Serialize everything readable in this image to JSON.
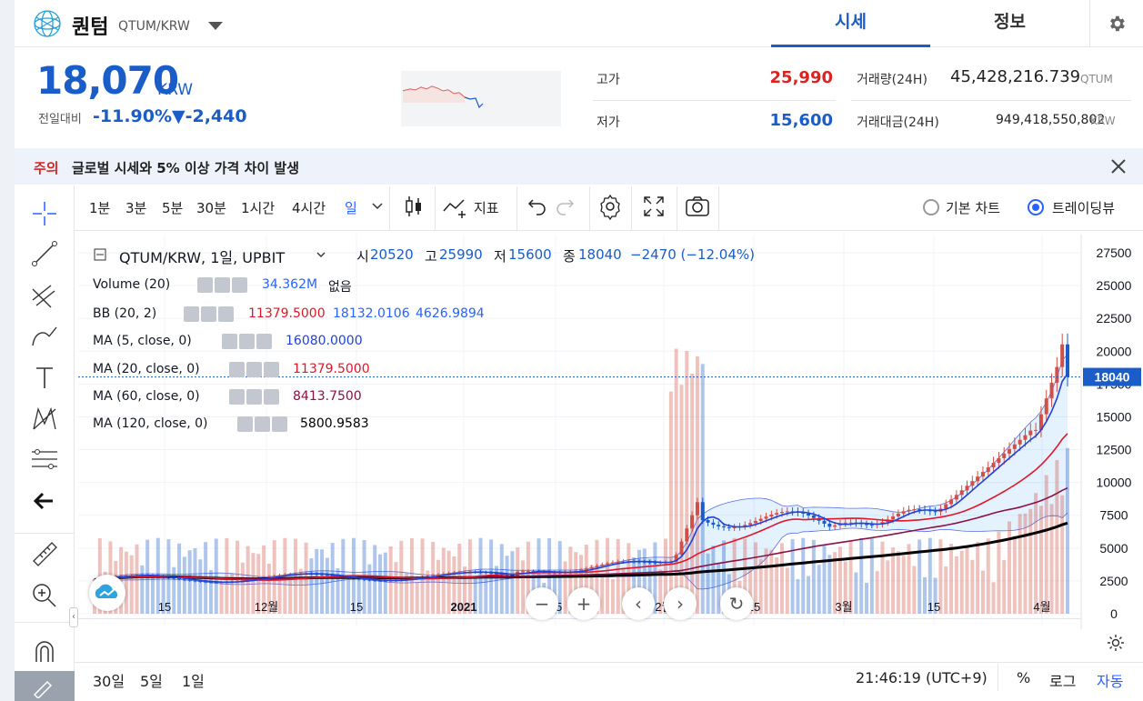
{
  "header": {
    "coin_name": "퀀텀",
    "pair": "QTUM/KRW",
    "tabs": [
      "시세",
      "정보"
    ]
  },
  "summary": {
    "price": "18,070",
    "unit": "KRW",
    "change_label": "전일대비",
    "change_pct": "-11.90%",
    "change_amt": "▼-2,440",
    "high_label": "고가",
    "high": "25,990",
    "low_label": "저가",
    "low": "15,600",
    "vol_label": "거래량(24H)",
    "vol": "45,428,216.739",
    "vol_unit": "QTUM",
    "amt_label": "거래대금(24H)",
    "amt": "949,418,550,802",
    "amt_unit": "KRW"
  },
  "notice": {
    "tag": "주의",
    "text": "글로벌 시세와 5% 이상 가격 차이 발생"
  },
  "toolbar": {
    "intervals": [
      "1분",
      "3분",
      "5분",
      "30분",
      "1시간",
      "4시간",
      "일"
    ],
    "indicator_label": "지표",
    "chart_basic": "기본 차트",
    "chart_tv": "트레이딩뷰"
  },
  "legend": {
    "symbol": "QTUM/KRW, 1일, UPBIT",
    "o_label": "시",
    "o": "20520",
    "h_label": "고",
    "h": "25990",
    "l_label": "저",
    "l": "15600",
    "c_label": "종",
    "c": "18040",
    "chg": "−2470 (−12.04%)",
    "volume": "Volume (20)",
    "volume_val": "34.362M",
    "volume_extra": "없음",
    "bb": "BB (20, 2)",
    "bb_v1": "11379.5000",
    "bb_v2": "18132.0106",
    "bb_v3": "4626.9894",
    "ma5": "MA (5, close, 0)",
    "ma5_v": "16080.0000",
    "ma20": "MA (20, close, 0)",
    "ma20_v": "11379.5000",
    "ma60": "MA (60, close, 0)",
    "ma60_v": "8413.7500",
    "ma120": "MA (120, close, 0)",
    "ma120_v": "5800.9583"
  },
  "chart_data": {
    "type": "candlestick",
    "y_ticks": [
      27500,
      25000,
      22500,
      20000,
      17500,
      15000,
      12500,
      10000,
      7500,
      5000,
      2500,
      0
    ],
    "last_price_label": "18040",
    "x_ticks": [
      "15",
      "12월",
      "15",
      "2021",
      "15",
      "2월",
      "15",
      "3월",
      "15",
      "4월"
    ]
  },
  "bottom": {
    "ranges": [
      "30일",
      "5일",
      "1일"
    ],
    "time": "21:46:19 (UTC+9)",
    "pct": "%",
    "log": "로그",
    "auto": "자동"
  },
  "colors": {
    "up": "#d24f45",
    "down": "#1a5dc8",
    "accent": "#1a5dc8"
  }
}
